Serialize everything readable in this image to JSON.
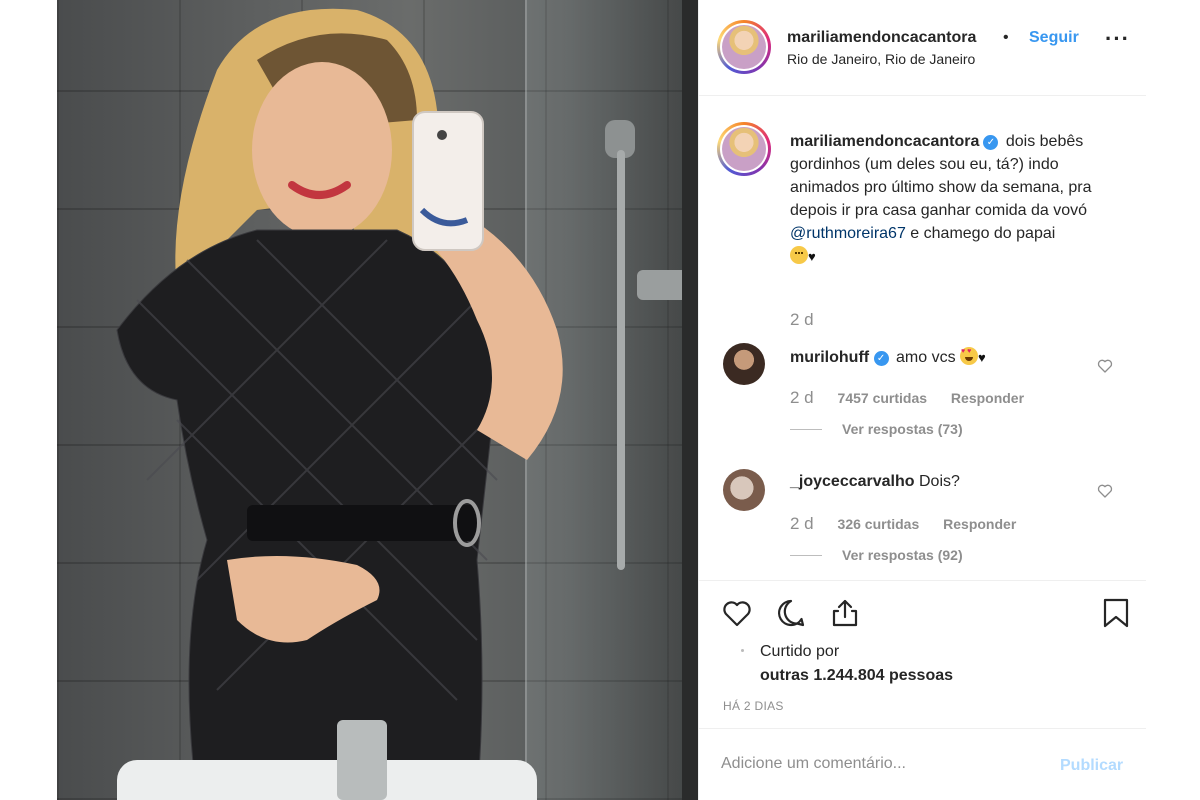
{
  "header": {
    "username": "mariliamendoncacantora",
    "separator": "•",
    "follow_label": "Seguir",
    "more_icon": "more-horizontal-icon",
    "location": "Rio de Janeiro, Rio de Janeiro"
  },
  "caption": {
    "username": "mariliamendoncacantora",
    "verified": true,
    "text_1": "dois bebês gordinhos (um deles sou eu, tá?) indo animados pro último show da semana, pra depois ir pra casa ganhar comida da vovó",
    "mention": "@ruthmoreira67",
    "text_2": "e chamego do papai",
    "time": "2 d"
  },
  "comments": [
    {
      "username": "murilohuff",
      "verified": true,
      "text": "amo vcs",
      "time": "2 d",
      "likes": "7457 curtidas",
      "reply_label": "Responder",
      "view_replies": "Ver respostas (73)"
    },
    {
      "username": "_joyceccarvalho",
      "verified": false,
      "text": "Dois?",
      "time": "2 d",
      "likes": "326 curtidas",
      "reply_label": "Responder",
      "view_replies": "Ver respostas (92)"
    }
  ],
  "actions": {
    "like_icon": "heart-outline-icon",
    "comment_icon": "comment-bubble-icon",
    "share_icon": "share-upload-icon",
    "save_icon": "bookmark-icon",
    "liked_by_label": "Curtido por",
    "liked_by_count": "outras 1.244.804 pessoas",
    "date": "HÁ 2 DIAS"
  },
  "add_comment": {
    "placeholder": "Adicione um comentário...",
    "publish_label": "Publicar"
  },
  "colors": {
    "link_blue": "#3897f0",
    "mention_blue": "#003569",
    "meta_gray": "#8e8e8e",
    "publish_disabled": "#b3dbff"
  }
}
